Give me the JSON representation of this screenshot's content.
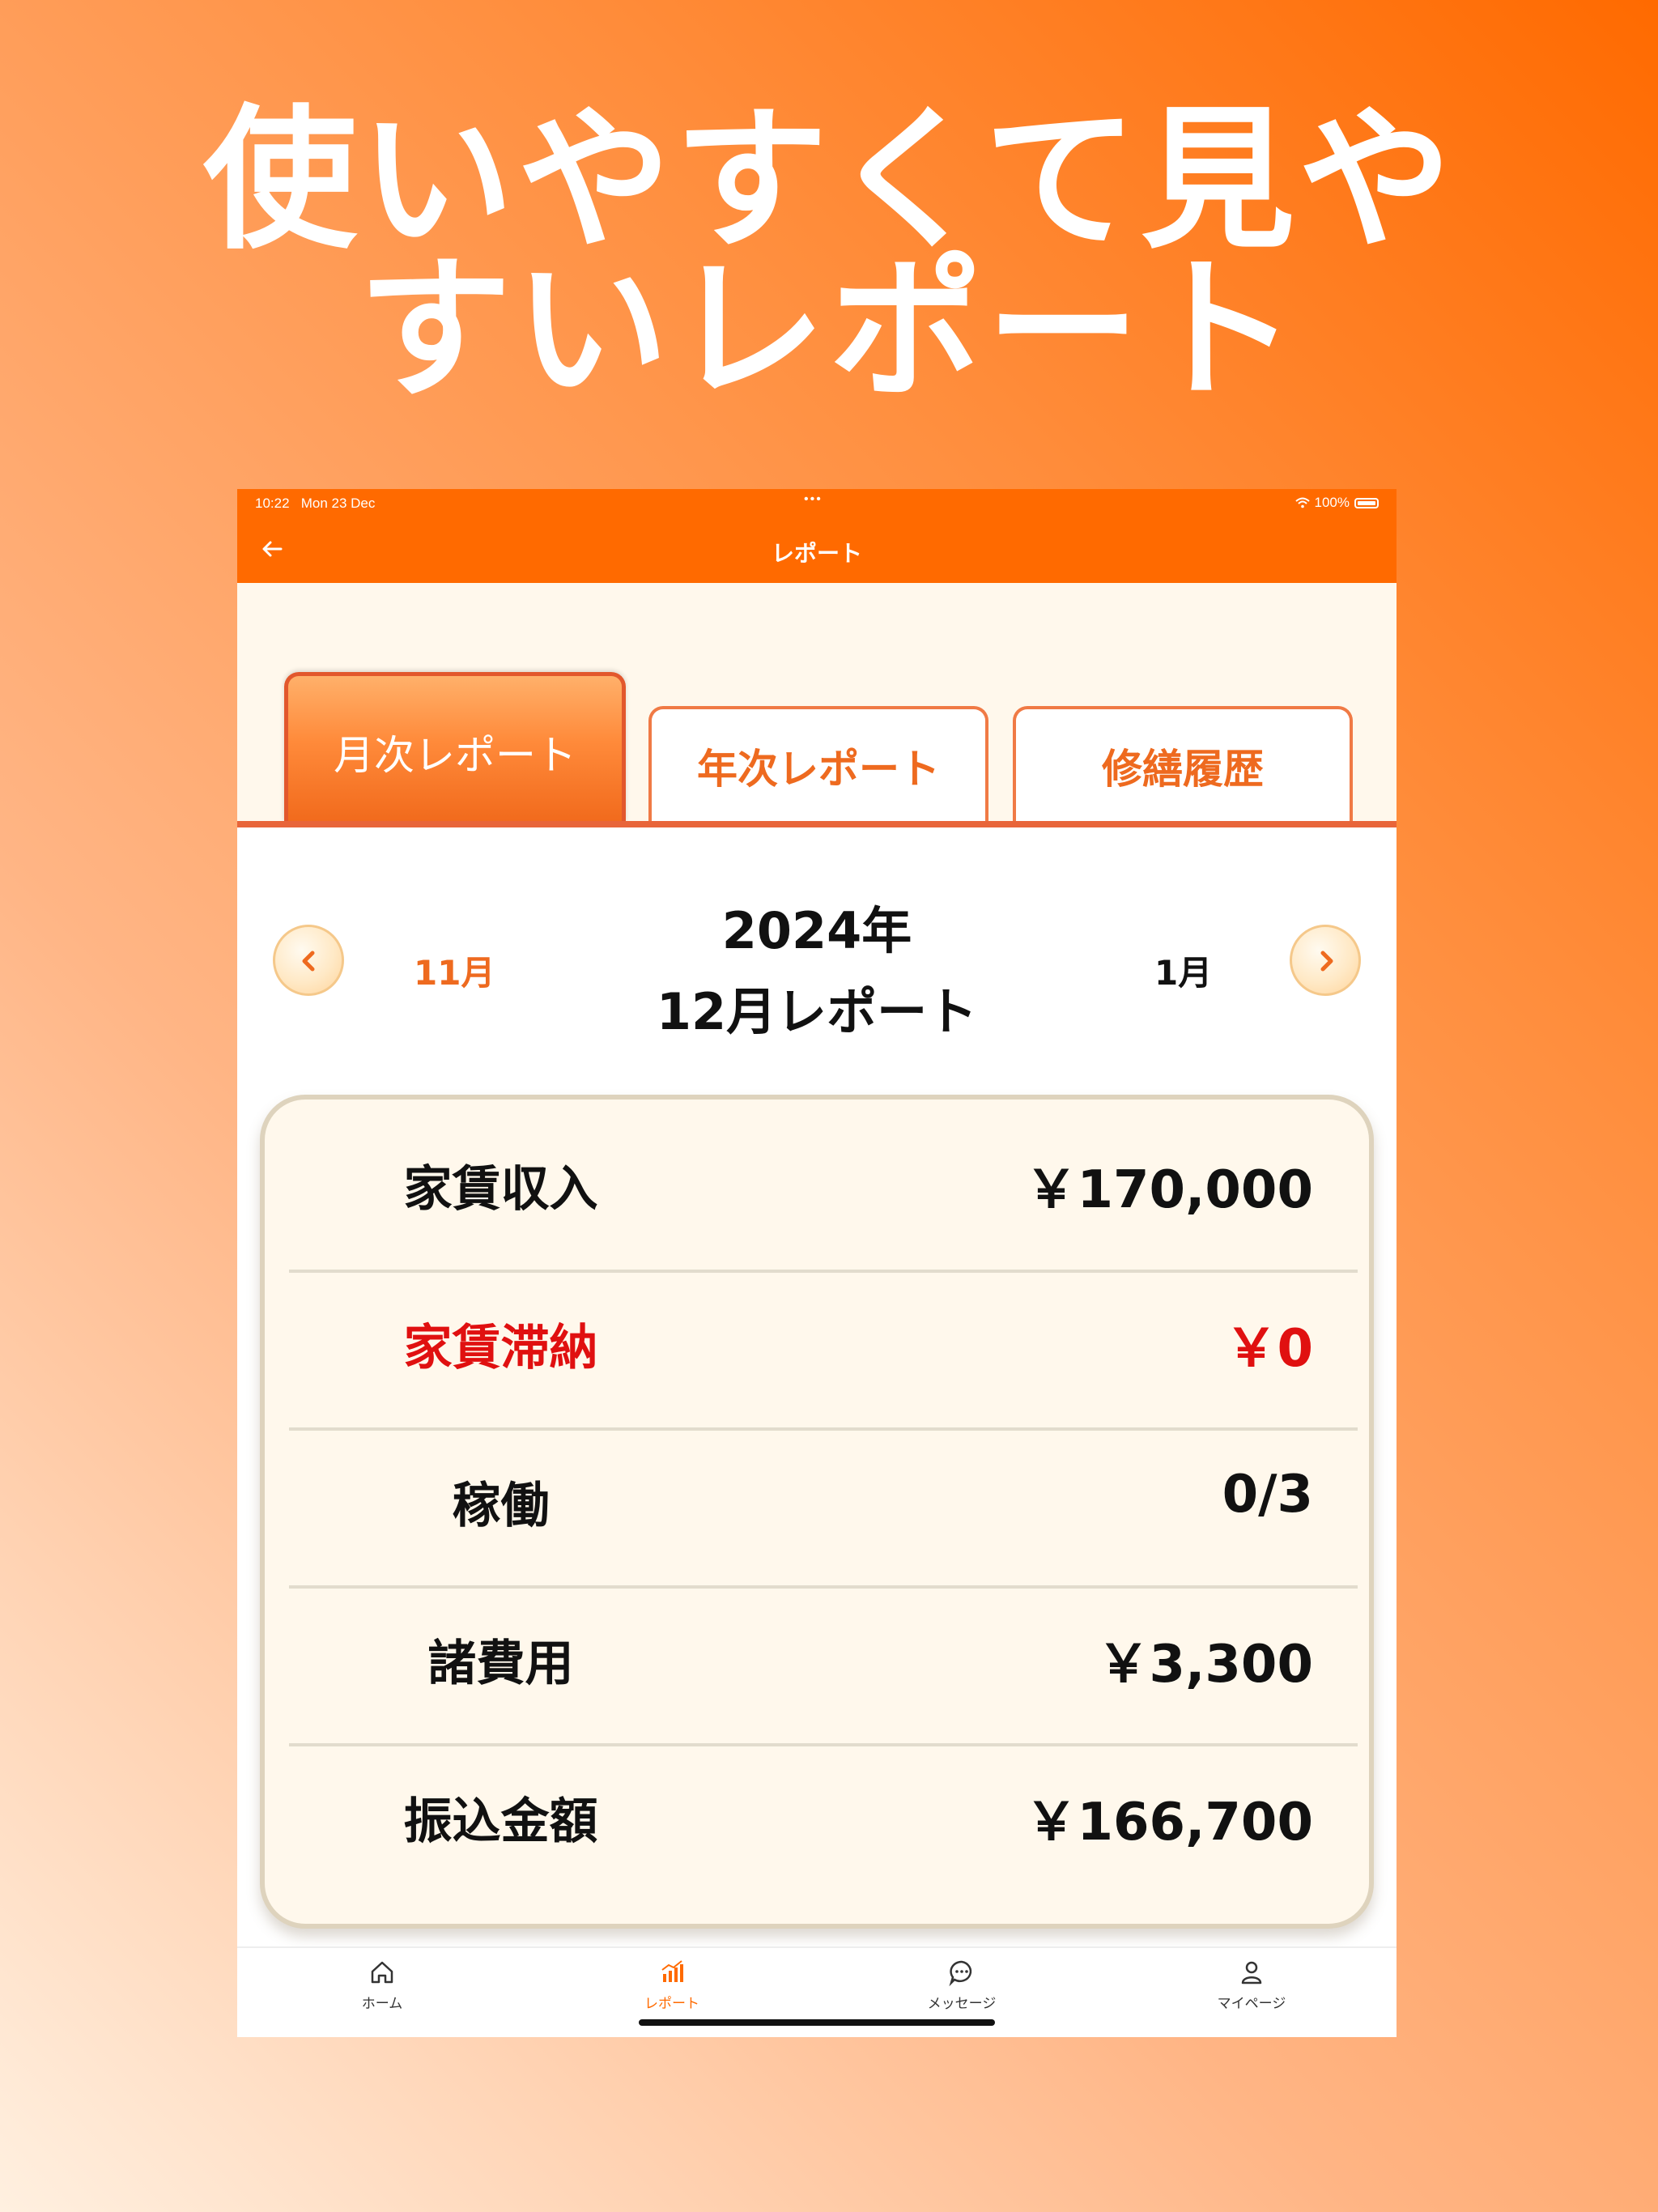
{
  "headline": {
    "line1": "使いやすくて見や",
    "line2": "すいレポート"
  },
  "status_bar": {
    "time": "10:22",
    "date": "Mon 23 Dec",
    "battery": "100%"
  },
  "nav_bar": {
    "title": "レポート"
  },
  "tabs": [
    {
      "label": "月次レポート",
      "active": true
    },
    {
      "label": "年次レポート",
      "active": false
    },
    {
      "label": "修繕履歴",
      "active": false
    }
  ],
  "month_nav": {
    "prev": "11月",
    "year": "2024年",
    "current": "12月レポート",
    "next": "1月"
  },
  "summary": [
    {
      "label": "家賃収入",
      "value": "￥170,000"
    },
    {
      "label": "家賃滞納",
      "value": "￥0",
      "color": "#e01010"
    },
    {
      "label": "稼働",
      "value": "0/3"
    },
    {
      "label": "諸費用",
      "value": "￥3,300"
    },
    {
      "label": "振込金額",
      "value": "￥166,700"
    }
  ],
  "bottom_tabs": [
    {
      "label": "ホーム",
      "icon": "home-icon",
      "active": false
    },
    {
      "label": "レポート",
      "icon": "chart-icon",
      "active": true
    },
    {
      "label": "メッセージ",
      "icon": "message-icon",
      "active": false
    },
    {
      "label": "マイページ",
      "icon": "person-icon",
      "active": false
    }
  ],
  "colors": {
    "accent": "#ff6a00",
    "tab_active": "#f16a1c",
    "card_bg": "#fff8ec",
    "alert_red": "#e01010"
  }
}
